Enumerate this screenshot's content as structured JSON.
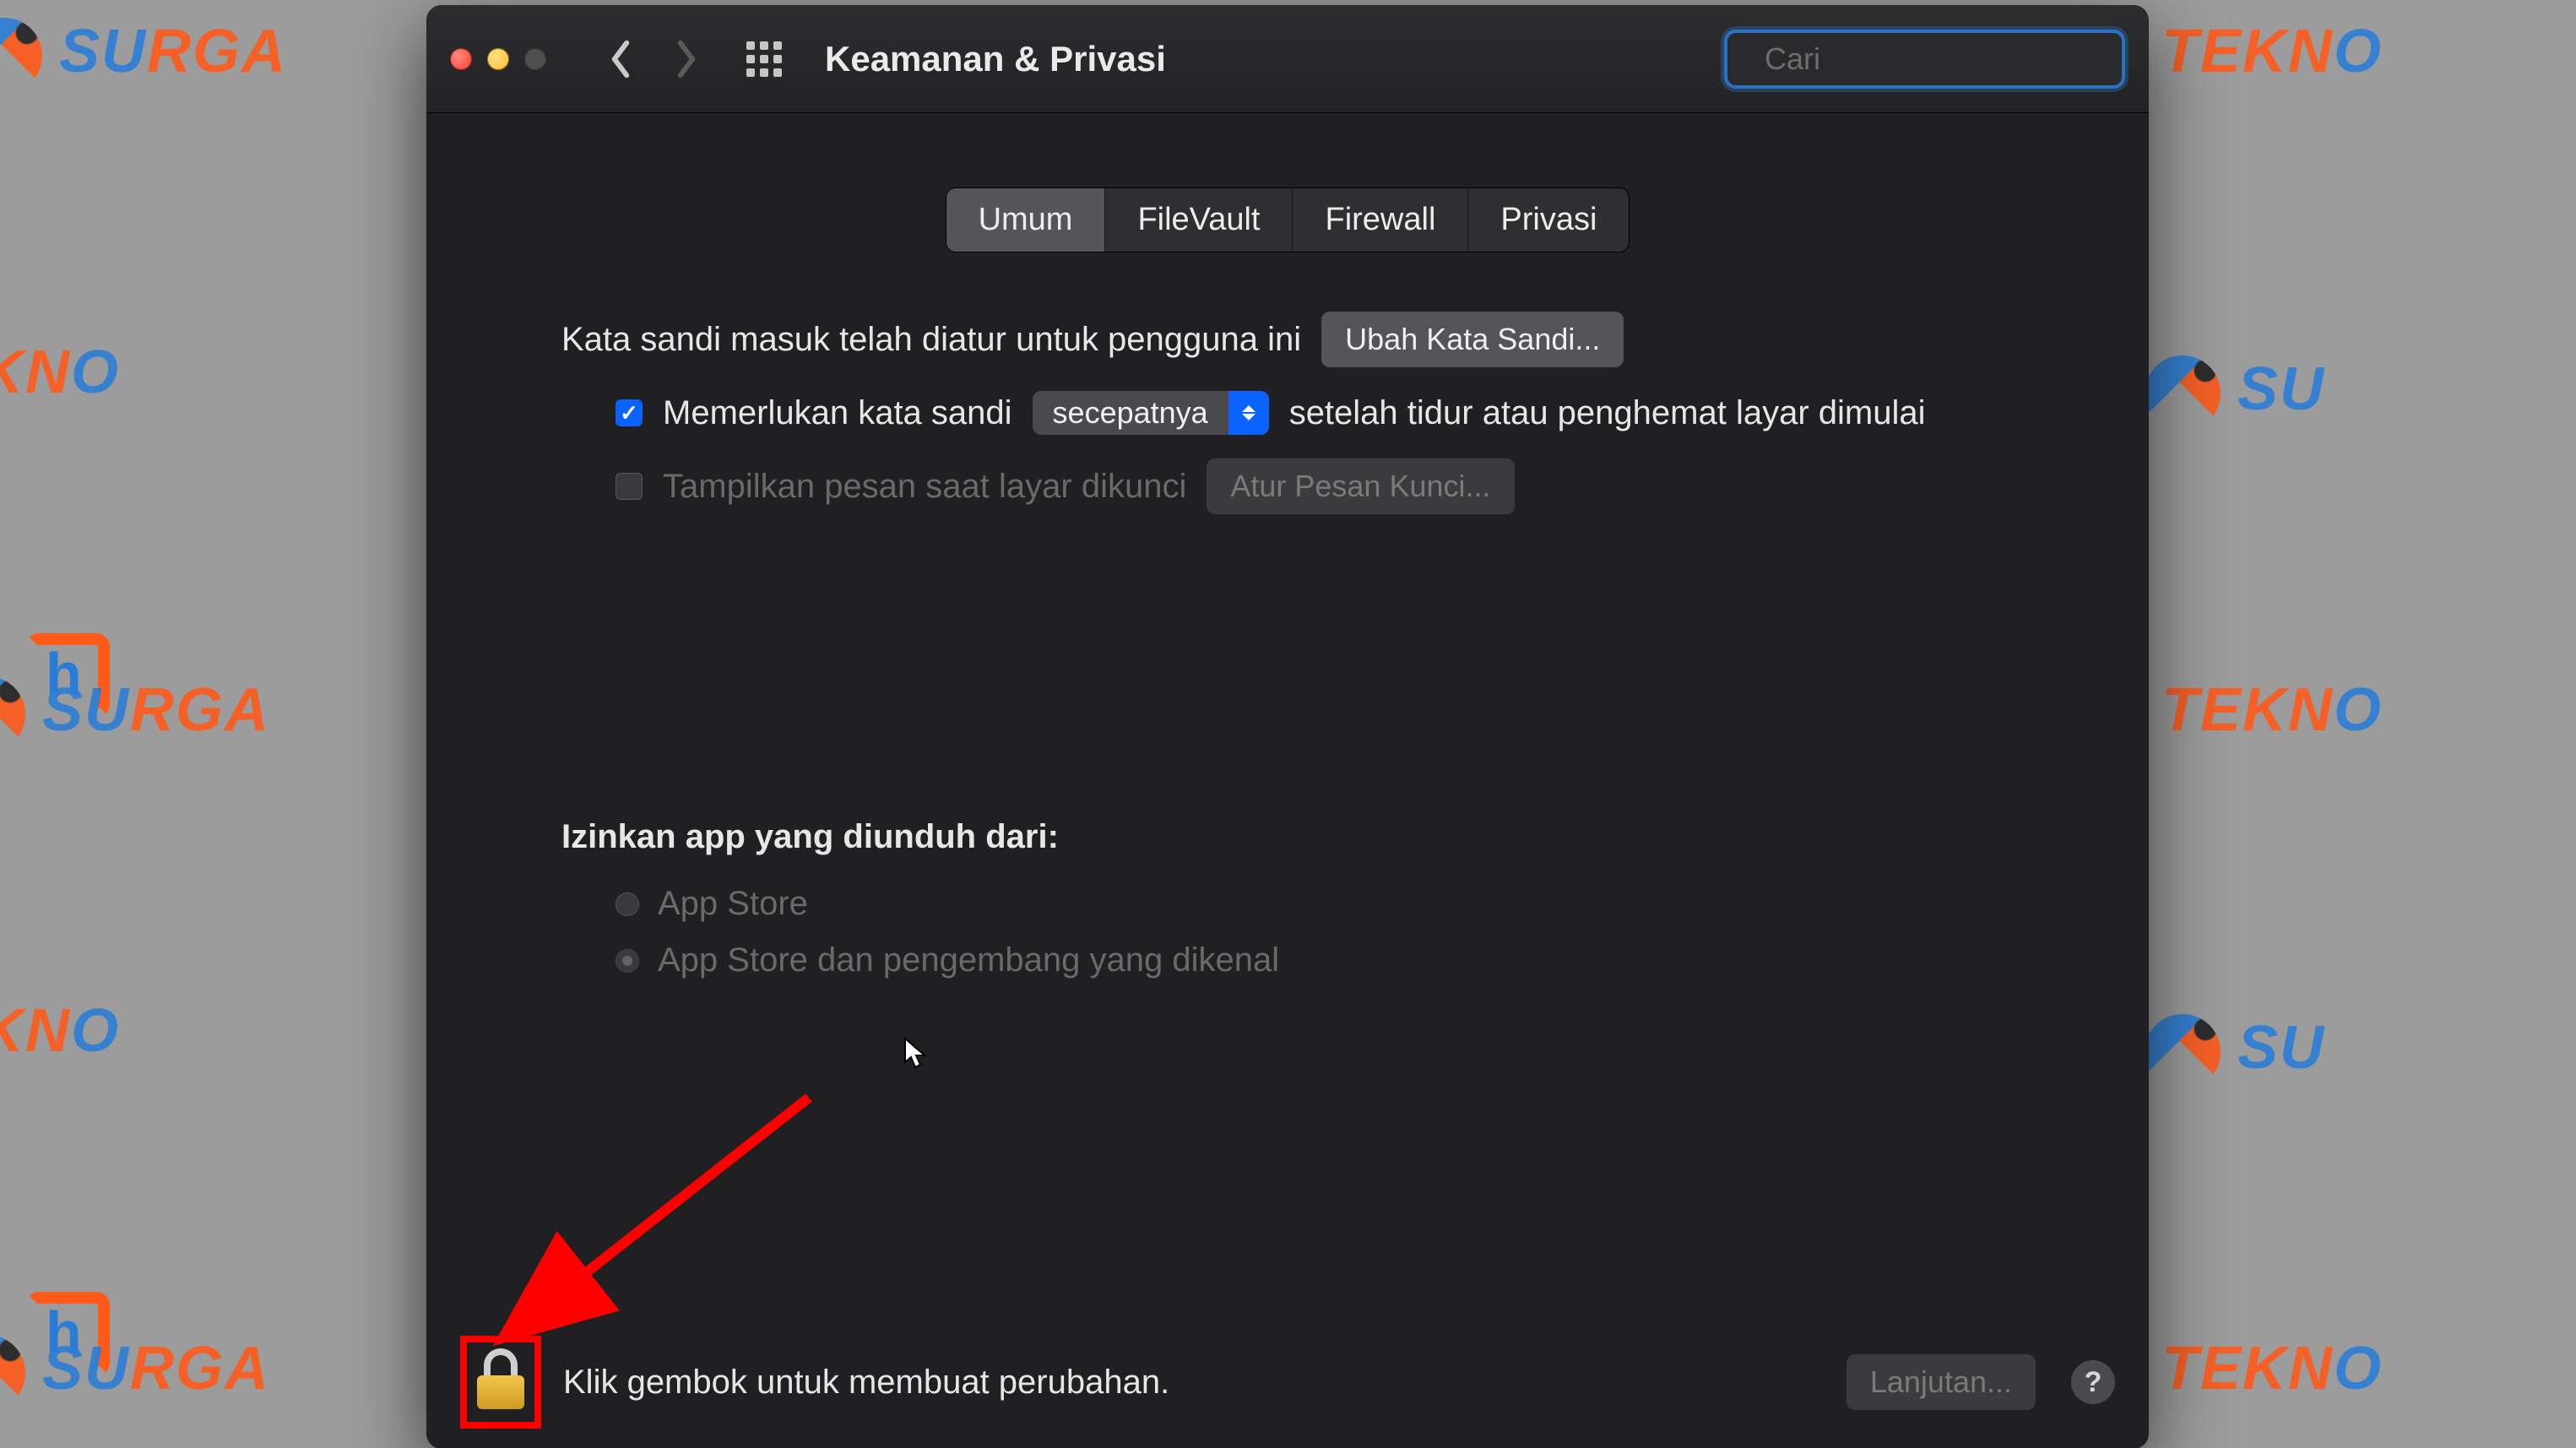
{
  "watermark": "SURGA TEKNO",
  "toolbar": {
    "title": "Keamanan & Privasi",
    "search_placeholder": "Cari"
  },
  "tabs": [
    {
      "label": "Umum",
      "active": true
    },
    {
      "label": "FileVault",
      "active": false
    },
    {
      "label": "Firewall",
      "active": false
    },
    {
      "label": "Privasi",
      "active": false
    }
  ],
  "general": {
    "password_set_text": "Kata sandi masuk telah diatur untuk pengguna ini",
    "change_password_button": "Ubah Kata Sandi...",
    "require_password_label": "Memerlukan kata sandi",
    "require_password_select": "secepatnya",
    "require_password_after": "setelah tidur atau penghemat layar dimulai",
    "show_lock_message_label": "Tampilkan pesan saat layar dikunci",
    "set_lock_message_button": "Atur Pesan Kunci...",
    "allow_apps_header": "Izinkan app yang diunduh dari:",
    "allow_apps_options": [
      {
        "label": "App Store",
        "selected": false
      },
      {
        "label": "App Store dan pengembang yang dikenal",
        "selected": true
      }
    ]
  },
  "footer": {
    "lock_hint": "Klik gembok untuk membuat perubahan.",
    "advanced_button": "Lanjutan...",
    "help_label": "?"
  }
}
